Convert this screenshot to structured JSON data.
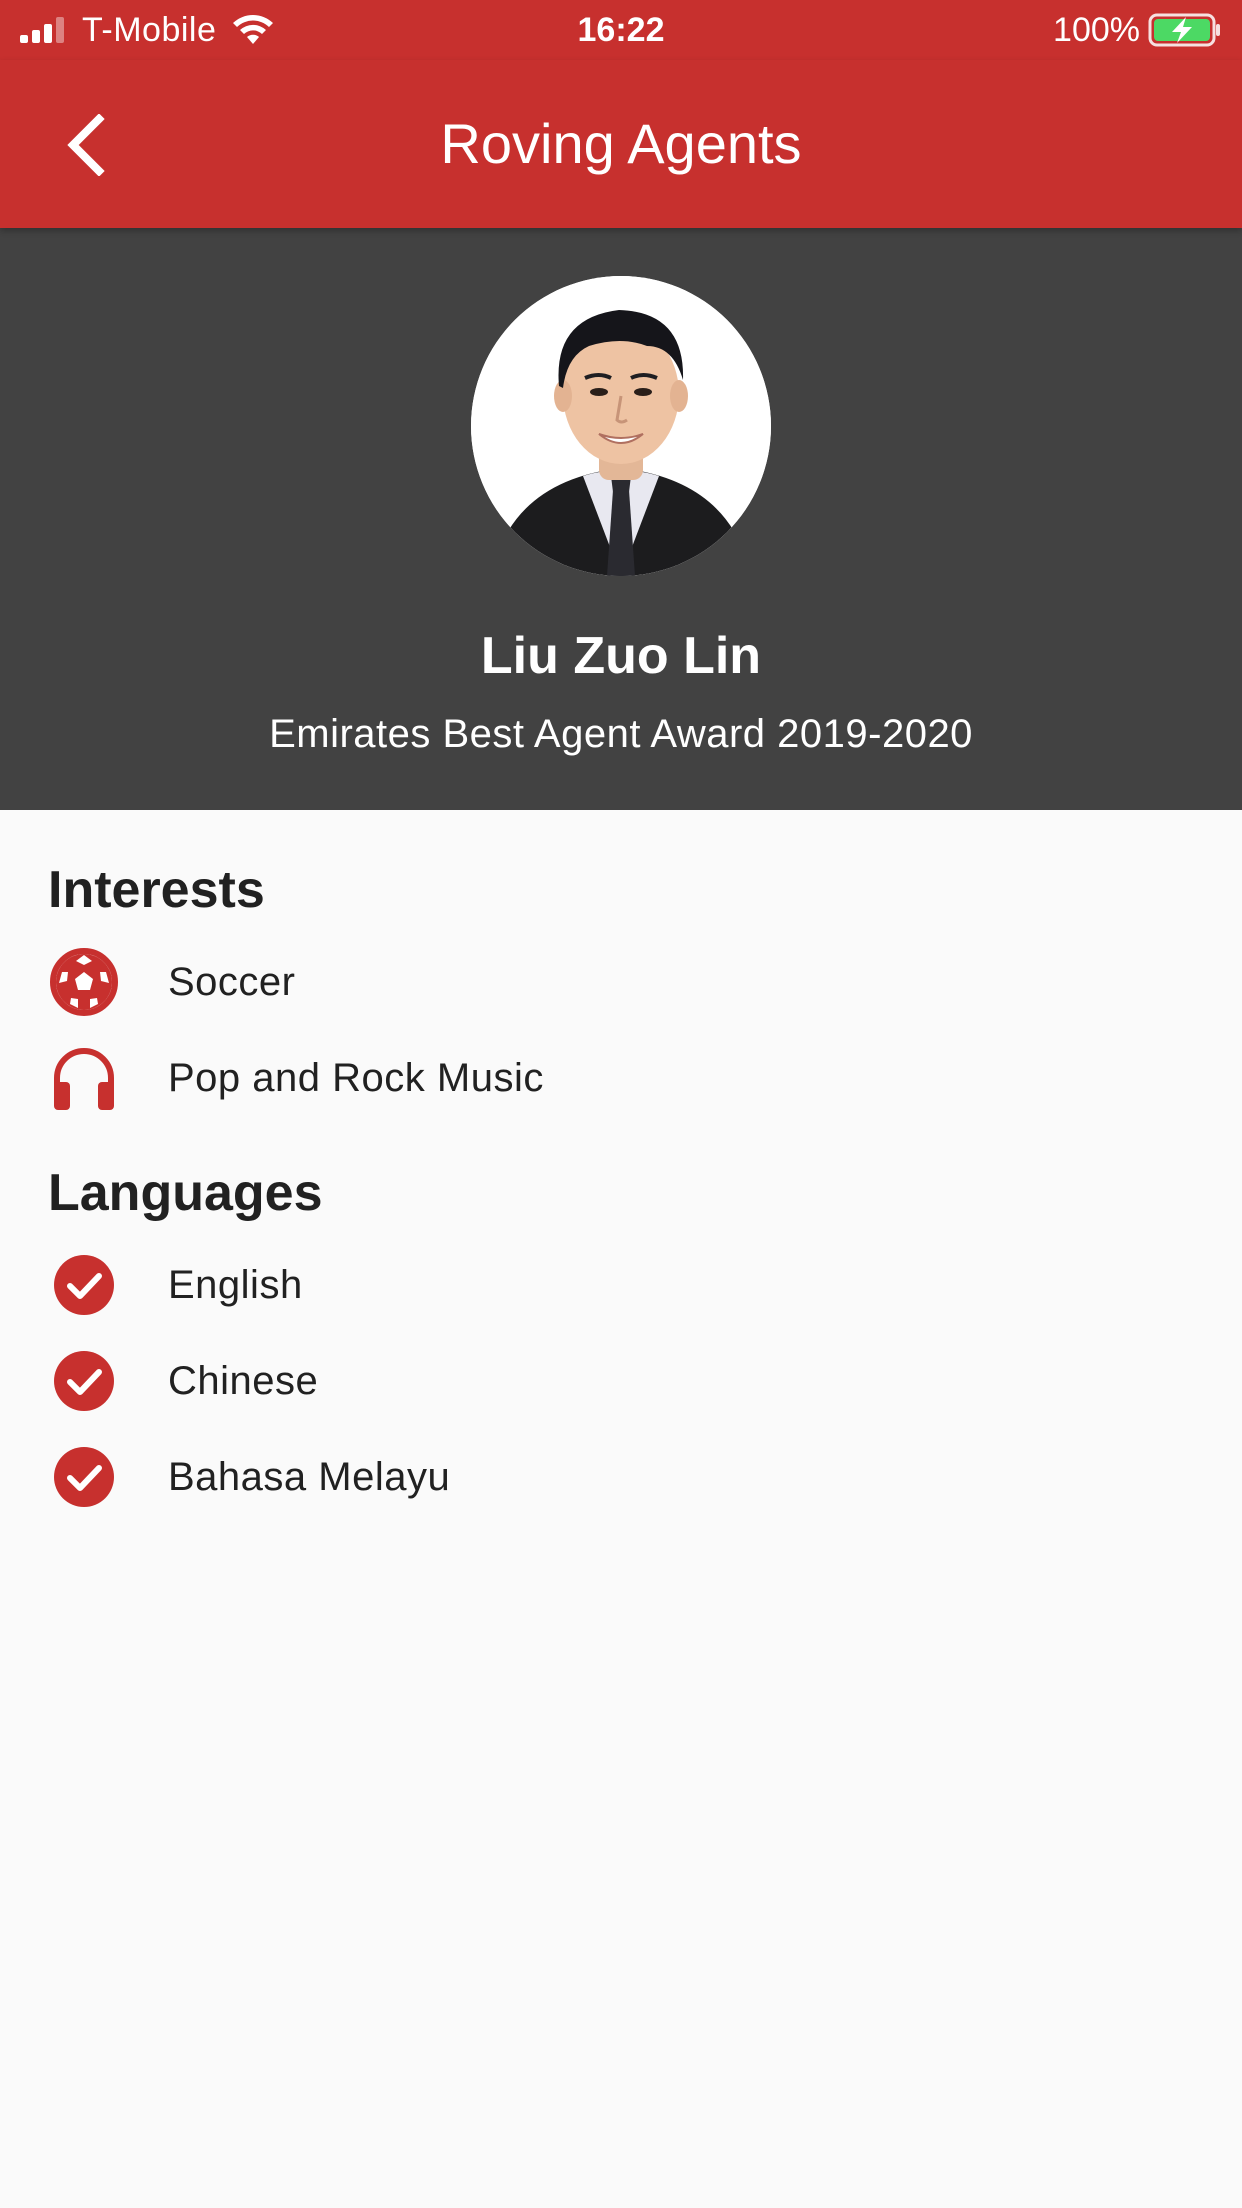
{
  "status_bar": {
    "carrier": "T-Mobile",
    "time": "16:22",
    "battery": "100%"
  },
  "app_bar": {
    "title": "Roving Agents",
    "back_icon": "chevron-left-icon"
  },
  "profile": {
    "name": "Liu Zuo Lin",
    "award": "Emirates Best Agent Award 2019-2020"
  },
  "interests": {
    "title": "Interests",
    "items": [
      {
        "label": "Soccer",
        "icon": "soccer-ball-icon"
      },
      {
        "label": "Pop and Rock Music",
        "icon": "headphones-icon"
      }
    ]
  },
  "languages": {
    "title": "Languages",
    "items": [
      {
        "label": "English",
        "icon": "check-circle-icon"
      },
      {
        "label": "Chinese",
        "icon": "check-circle-icon"
      },
      {
        "label": "Bahasa Melayu",
        "icon": "check-circle-icon"
      }
    ]
  },
  "colors": {
    "primary": "#c7302e",
    "header_bg": "#424242",
    "background": "#fafafa",
    "text": "#212121"
  }
}
